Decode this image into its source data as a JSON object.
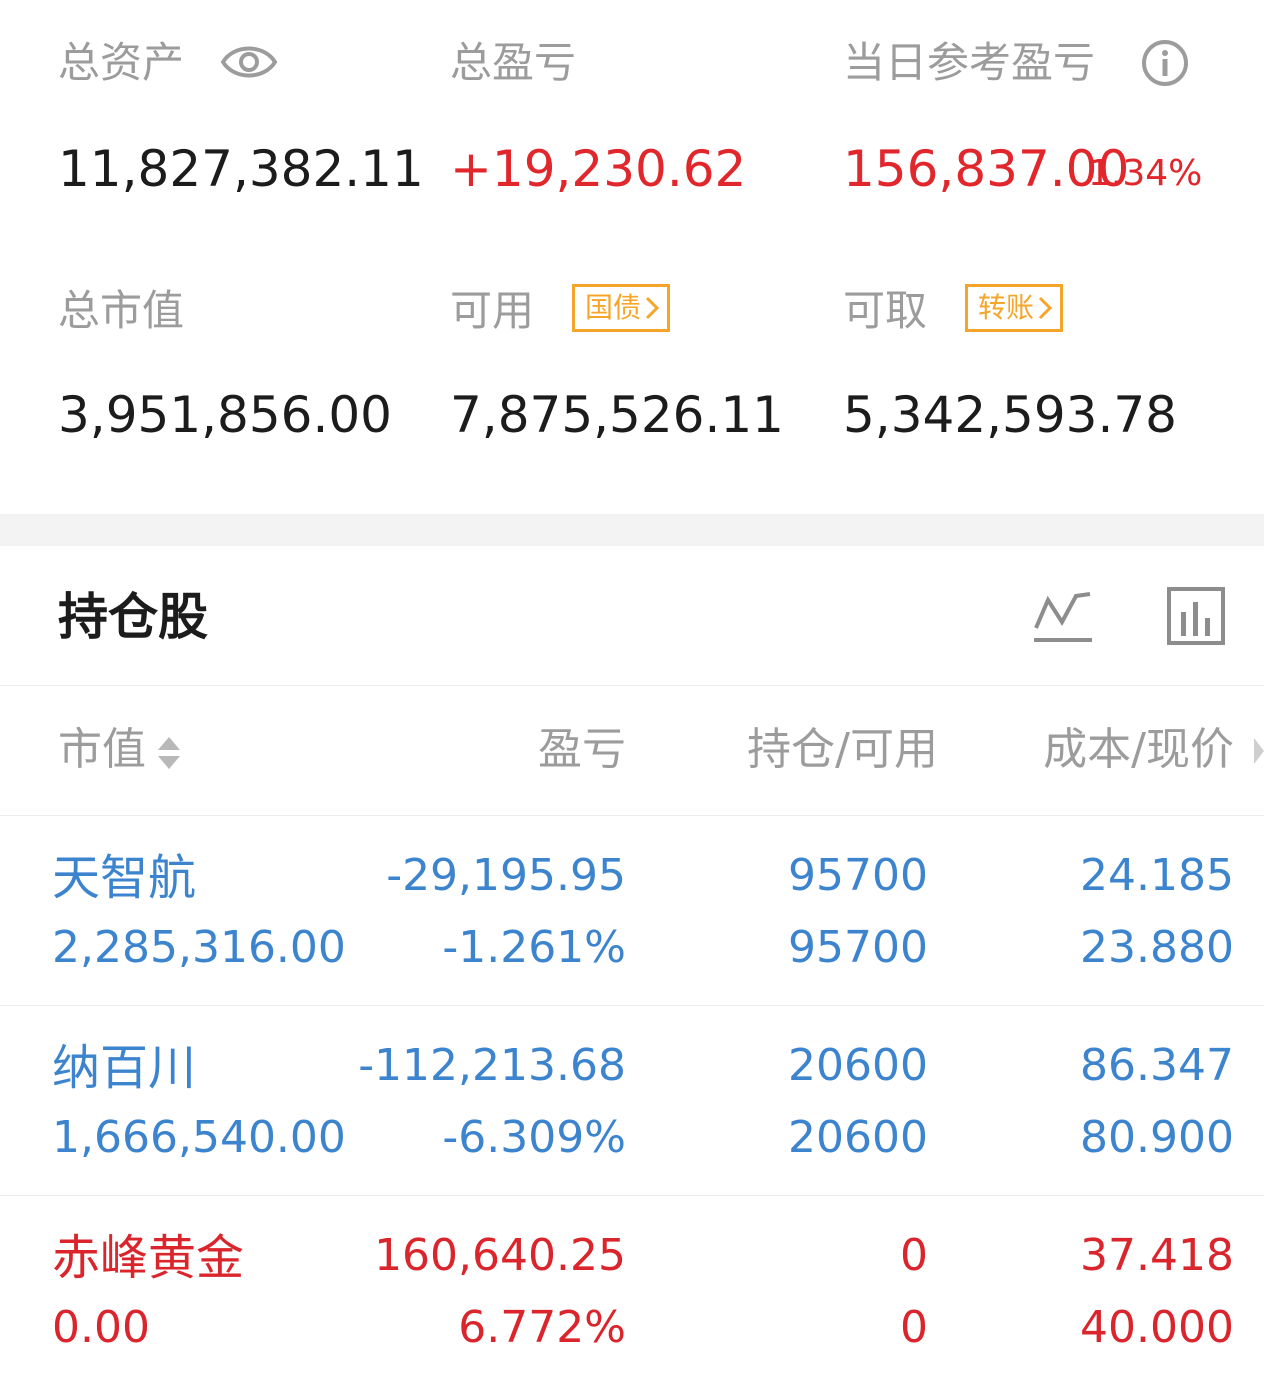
{
  "summary": {
    "total_assets_label": "总资产",
    "total_assets_value": "11,827,382.11",
    "total_pl_label": "总盈亏",
    "total_pl_value": "+19,230.62",
    "daily_pl_label": "当日参考盈亏",
    "daily_pl_value": "156,837.00",
    "daily_pl_pct": "1.34%",
    "market_value_label": "总市值",
    "market_value_value": "3,951,856.00",
    "available_label": "可用",
    "available_tag": "国债",
    "available_value": "7,875,526.11",
    "withdrawable_label": "可取",
    "withdrawable_tag": "转账",
    "withdrawable_value": "5,342,593.78"
  },
  "holdings": {
    "title": "持仓股",
    "columns": {
      "market_value": "市值",
      "pl": "盈亏",
      "position": "持仓/可用",
      "cost_price": "成本/现价"
    },
    "rows": [
      {
        "name": "天智航",
        "market_value": "2,285,316.00",
        "pl": "-29,195.95",
        "pl_pct": "-1.261%",
        "position": "95700",
        "available": "95700",
        "cost": "24.185",
        "price": "23.880",
        "color": "#3d84cf"
      },
      {
        "name": "纳百川",
        "market_value": "1,666,540.00",
        "pl": "-112,213.68",
        "pl_pct": "-6.309%",
        "position": "20600",
        "available": "20600",
        "cost": "86.347",
        "price": "80.900",
        "color": "#3d84cf"
      },
      {
        "name": "赤峰黄金",
        "market_value": "0.00",
        "pl": "160,640.25",
        "pl_pct": "6.772%",
        "position": "0",
        "available": "0",
        "cost": "37.418",
        "price": "40.000",
        "color": "#d9252b"
      }
    ]
  },
  "icons": {
    "eye": "eye-icon",
    "info": "info-icon",
    "chevron": "chevron-right-icon",
    "line_chart": "line-chart-icon",
    "bar_chart": "bar-chart-icon",
    "sort": "sort-icon"
  },
  "colors": {
    "up": "#e1262c",
    "down": "#3d84cf",
    "tag": "#f4a52a",
    "label": "#9c9c9c"
  }
}
